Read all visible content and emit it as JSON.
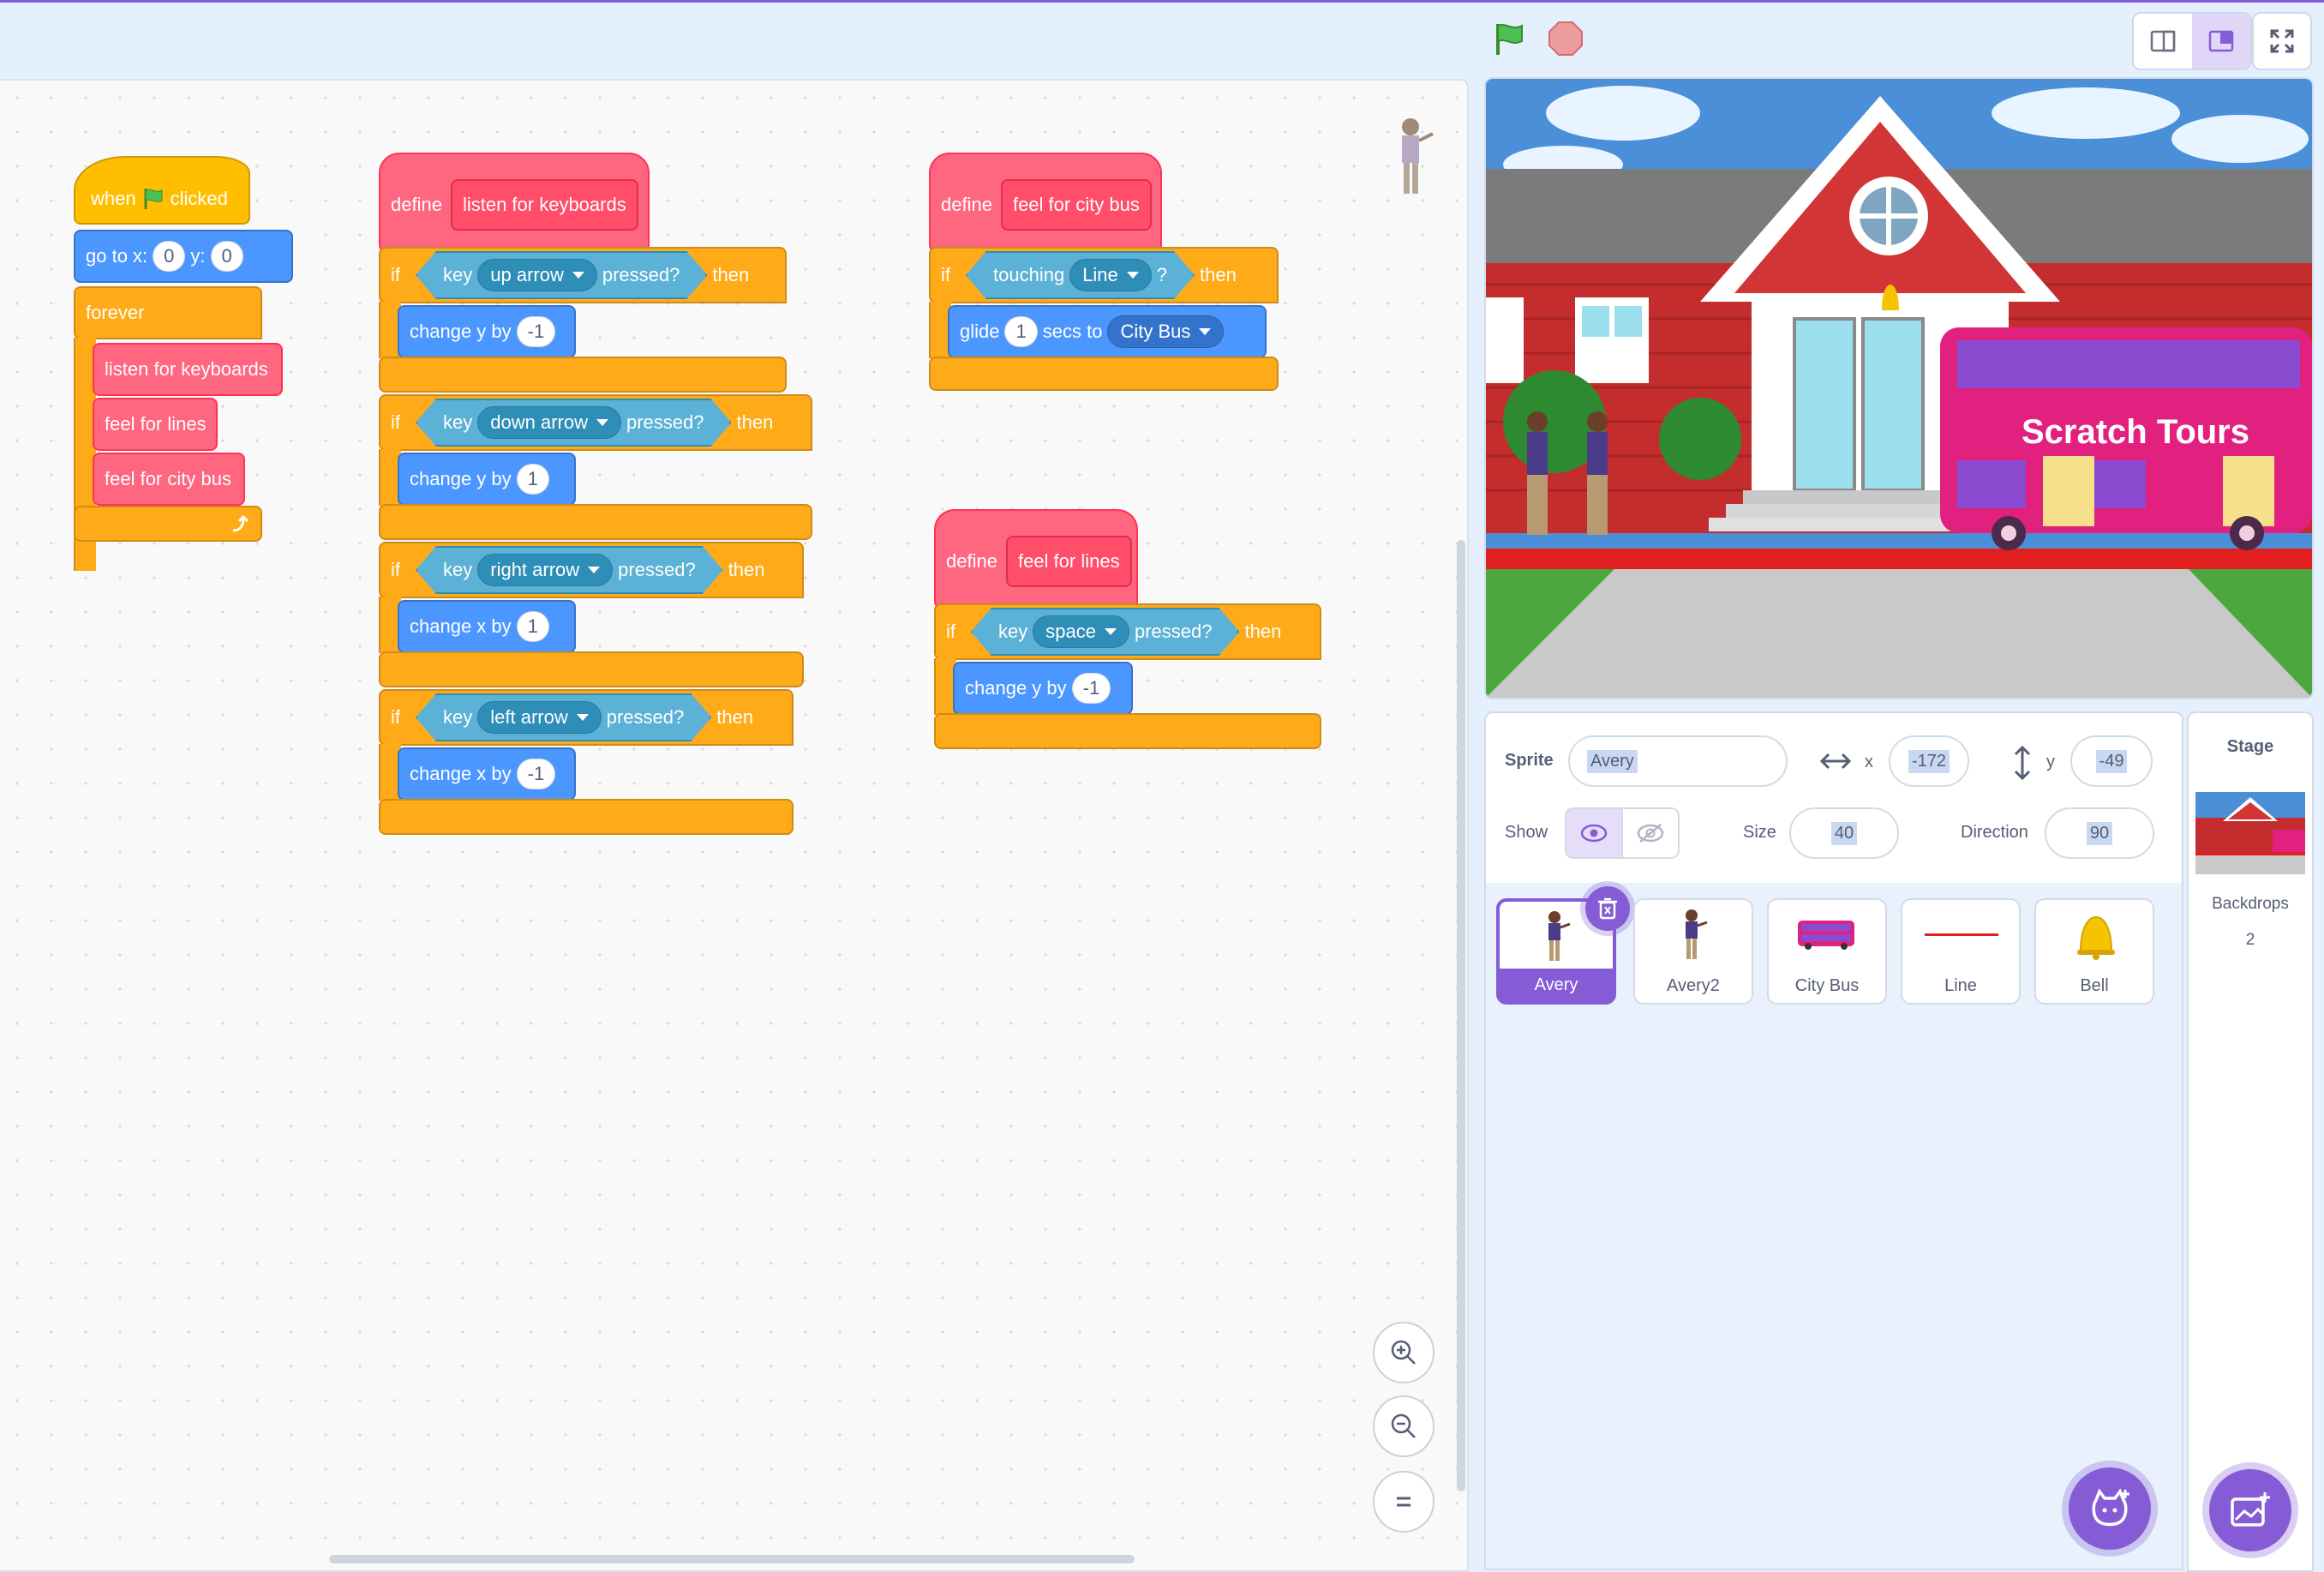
{
  "colors": {
    "accent": "#855cd6",
    "events": "#ffbf00",
    "motion": "#4c97ff",
    "control": "#ffab19",
    "my_blocks": "#ff6680",
    "sensing": "#5cb1d6"
  },
  "toolbar": {
    "green_flag": "green-flag-icon",
    "stop": "stop-icon",
    "small_stage": "small-stage-mode",
    "normal_stage": "normal-stage-mode",
    "fullscreen": "fullscreen-icon"
  },
  "scripts": {
    "main": {
      "when": "when",
      "clicked": "clicked",
      "goto": "go to x:",
      "goto_x": "0",
      "goto_y_label": "y:",
      "goto_y": "0",
      "forever": "forever",
      "call1": "listen for keyboards",
      "call2": "feel for lines",
      "call3": "feel for city bus"
    },
    "keyboards": {
      "define": "define",
      "name": "listen for keyboards",
      "ifs": [
        {
          "if": "if",
          "key": "key",
          "option": "up arrow",
          "pressed": "pressed?",
          "then": "then",
          "action": "change y by",
          "value": "-1"
        },
        {
          "if": "if",
          "key": "key",
          "option": "down arrow",
          "pressed": "pressed?",
          "then": "then",
          "action": "change y by",
          "value": "1"
        },
        {
          "if": "if",
          "key": "key",
          "option": "right arrow",
          "pressed": "pressed?",
          "then": "then",
          "action": "change x by",
          "value": "1"
        },
        {
          "if": "if",
          "key": "key",
          "option": "left arrow",
          "pressed": "pressed?",
          "then": "then",
          "action": "change x by",
          "value": "-1"
        }
      ]
    },
    "citybus": {
      "define": "define",
      "name": "feel for city bus",
      "if": "if",
      "touching": "touching",
      "object": "Line",
      "q": "?",
      "then": "then",
      "glide": "glide",
      "secs_value": "1",
      "secs_to": "secs to",
      "target": "City Bus"
    },
    "lines": {
      "define": "define",
      "name": "feel for lines",
      "if": "if",
      "key": "key",
      "option": "space",
      "pressed": "pressed?",
      "then": "then",
      "action": "change y by",
      "value": "-1"
    }
  },
  "stage": {
    "bus_text": "Scratch Tours"
  },
  "sprite_info": {
    "sprite_label": "Sprite",
    "sprite_name": "Avery",
    "x_label": "x",
    "x_value": "-172",
    "y_label": "y",
    "y_value": "-49",
    "show_label": "Show",
    "size_label": "Size",
    "size_value": "40",
    "direction_label": "Direction",
    "direction_value": "90"
  },
  "sprites": [
    {
      "name": "Avery",
      "selected": true
    },
    {
      "name": "Avery2",
      "selected": false
    },
    {
      "name": "City Bus",
      "selected": false
    },
    {
      "name": "Line",
      "selected": false
    },
    {
      "name": "Bell",
      "selected": false
    }
  ],
  "stage_panel": {
    "title": "Stage",
    "backdrops_label": "Backdrops",
    "backdrops_count": "2"
  }
}
